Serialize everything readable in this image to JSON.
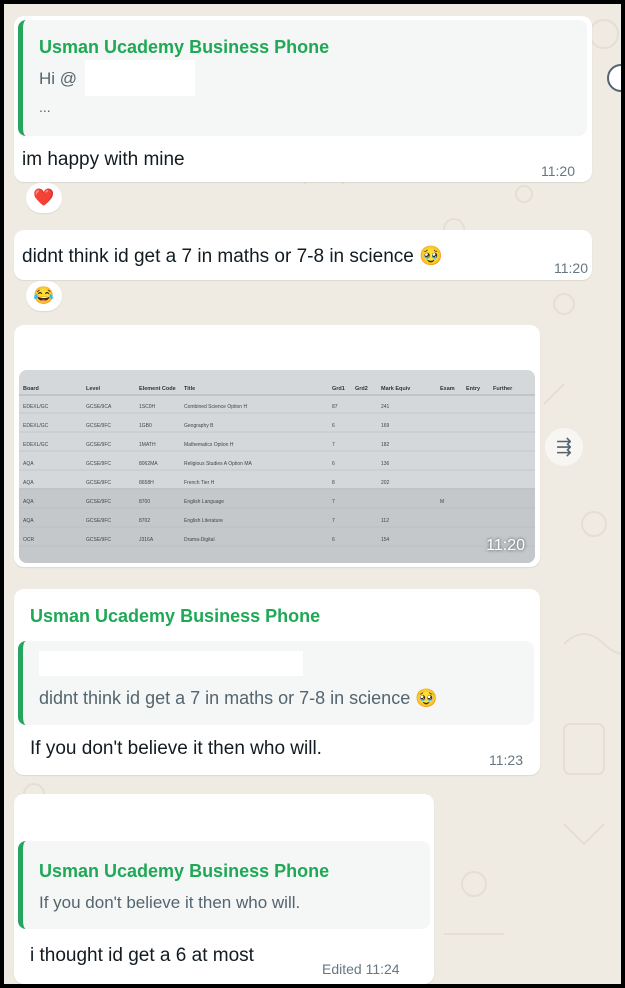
{
  "colors": {
    "accent": "#1fa855",
    "chat_bg": "#efeae2",
    "bubble": "#ffffff",
    "quote_bg": "#f5f6f6",
    "meta": "#667781"
  },
  "messages": [
    {
      "quote_sender": "Usman Ucademy Business Phone",
      "quote_line1": "Hi @",
      "quote_line2": "...",
      "text": "im happy with mine",
      "time": "11:20",
      "reaction": "❤️"
    },
    {
      "text": "didnt think id get a 7 in maths or 7-8 in science 🥹",
      "time": "11:20",
      "reaction": "😂"
    },
    {
      "image_time": "11:20"
    },
    {
      "sender": "Usman Ucademy Business Phone",
      "quote_text": "didnt think id get a 7 in maths or 7-8 in science 🥹",
      "text": "If you don't believe it then who will.",
      "time": "11:23"
    },
    {
      "quote_sender": "Usman Ucademy Business Phone",
      "quote_text": "If you don't believe it then who will.",
      "text": "i thought id get a 6 at most",
      "time": "Edited 11:24"
    }
  ],
  "results_table": {
    "headers": [
      "Board",
      "Level",
      "Element Code",
      "Title",
      "Grd1",
      "Grd2",
      "Mark Equiv",
      "Exam",
      "Entry",
      "Further"
    ],
    "rows": [
      [
        "EDEXL/GC",
        "GCSE/9CA",
        "1SC0H",
        "Combined Science Option H",
        "87",
        "",
        "241"
      ],
      [
        "EDEXL/GC",
        "GCSE/9FC",
        "1GB0",
        "Geography B",
        "6",
        "",
        "169"
      ],
      [
        "EDEXL/GC",
        "GCSE/9FC",
        "1MATH",
        "Mathematics Option H",
        "7",
        "",
        "182"
      ],
      [
        "AQA",
        "GCSE/9FC",
        "8062MA",
        "Religious Studies A Option MA",
        "6",
        "",
        "136"
      ],
      [
        "AQA",
        "GCSE/9FC",
        "8658H",
        "French Tier H",
        "8",
        "",
        "202"
      ],
      [
        "AQA",
        "GCSE/9FC",
        "8700",
        "English Language",
        "7",
        "",
        "",
        "M"
      ],
      [
        "AQA",
        "GCSE/9FC",
        "8702",
        "English Literature",
        "7",
        "",
        "112"
      ],
      [
        "OCR",
        "GCSE/9FC",
        "J316A",
        "Drama-Digital",
        "6",
        "",
        "154"
      ]
    ]
  },
  "icons": {
    "forward": "forward-icon",
    "edge": "reaction-picker-icon"
  }
}
